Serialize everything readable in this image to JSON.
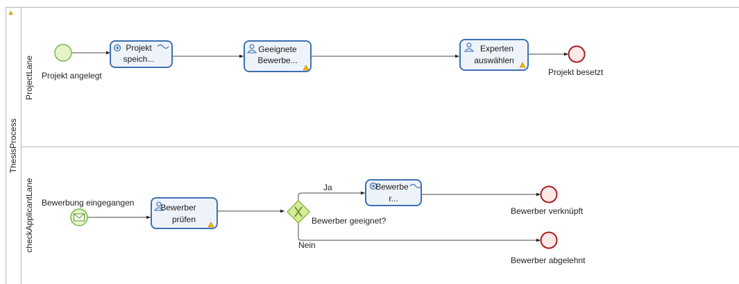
{
  "pool": {
    "label": "ThesisProcess"
  },
  "lanes": {
    "project": {
      "label": "ProjectLane"
    },
    "check": {
      "label": "checkApplicantLane"
    }
  },
  "events": {
    "project_start": {
      "label": "Projekt angelegt"
    },
    "project_end": {
      "label": "Projekt besetzt"
    },
    "msg_start": {
      "label": "Bewerbung eingegangen"
    },
    "end_linked": {
      "label": "Bewerber verknüpft"
    },
    "end_rejected": {
      "label": "Bewerber abgelehnt"
    }
  },
  "tasks": {
    "projekt_speich": {
      "line1": "Projekt",
      "line2": "speich...",
      "kind": "service"
    },
    "geeignete": {
      "line1": "Geeignete",
      "line2": "Bewerbe...",
      "kind": "user"
    },
    "experten": {
      "line1": "Experten",
      "line2": "auswählen",
      "kind": "user"
    },
    "bewerber_pruefen": {
      "line1": "Bewerber",
      "line2": "prüfen",
      "kind": "user"
    },
    "bewerber_r": {
      "line1": "Bewerbe",
      "line2": "r...",
      "kind": "service"
    }
  },
  "gateway": {
    "label": "Bewerber geeignet?"
  },
  "flows": {
    "yes": "Ja",
    "no": "Nein"
  },
  "colors": {
    "start_fill": "#e4f4c8",
    "start_stroke": "#7ab648",
    "end_fill": "#fde8e8",
    "end_stroke": "#a81e1e",
    "task_fill": "#eef3fa",
    "task_stroke": "#3c6fb0",
    "gateway_fill": "#d7ec9b",
    "gateway_stroke": "#8fb83a",
    "warning": "#f4b400"
  }
}
